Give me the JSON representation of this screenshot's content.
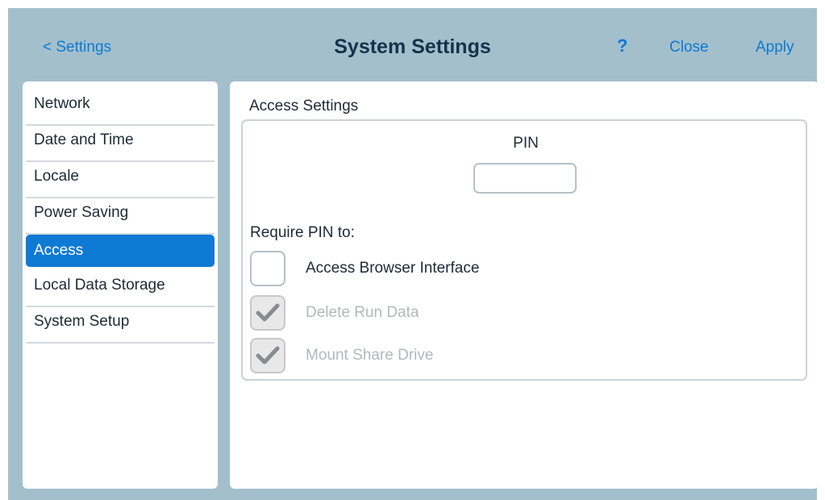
{
  "header": {
    "back_label": "< Settings",
    "title": "System Settings",
    "help_label": "?",
    "close_label": "Close",
    "apply_label": "Apply"
  },
  "sidebar": {
    "items": [
      {
        "label": "Network",
        "active": false
      },
      {
        "label": "Date and Time",
        "active": false
      },
      {
        "label": "Locale",
        "active": false
      },
      {
        "label": "Power Saving",
        "active": false
      },
      {
        "label": "Access",
        "active": true
      },
      {
        "label": "Local Data Storage",
        "active": false
      },
      {
        "label": "System Setup",
        "active": false
      }
    ]
  },
  "main": {
    "section_title": "Access Settings",
    "pin_label": "PIN",
    "pin_value": "",
    "require_label": "Require PIN to:",
    "options": [
      {
        "label": "Access Browser Interface",
        "checked": false,
        "disabled": false
      },
      {
        "label": "Delete Run Data",
        "checked": true,
        "disabled": true
      },
      {
        "label": "Mount Share Drive",
        "checked": true,
        "disabled": true
      }
    ]
  },
  "colors": {
    "accent": "#0f7ad3",
    "header_bg": "#a3bfcc",
    "title": "#14324a",
    "disabled_text": "#b4b8bb"
  },
  "icons": {
    "checkmark": "check-icon"
  }
}
